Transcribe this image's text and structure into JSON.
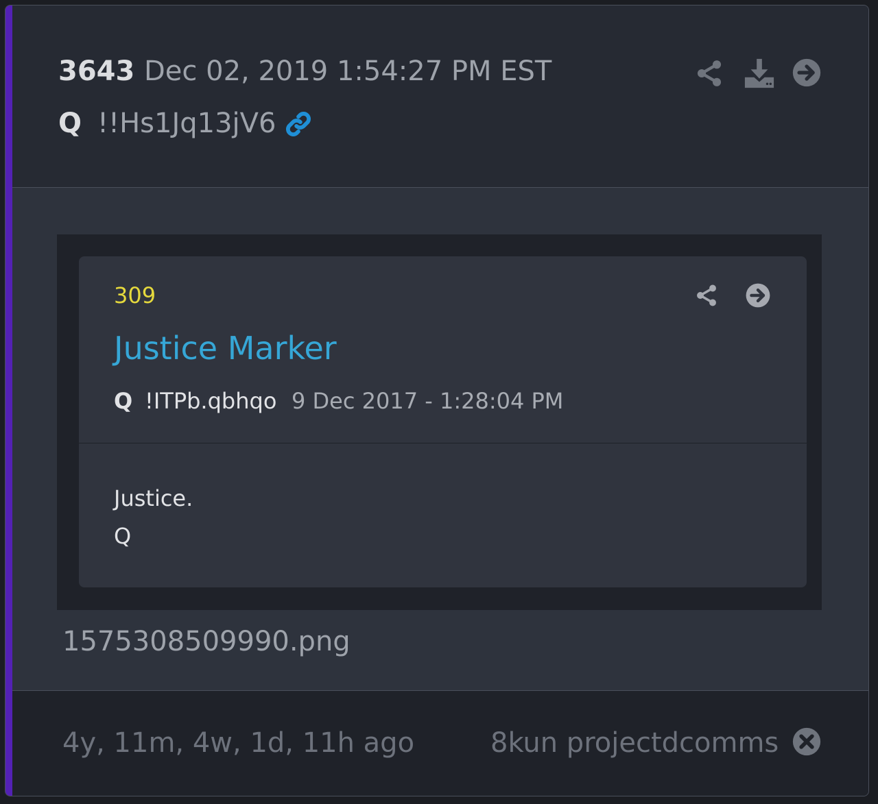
{
  "post": {
    "number": "3643",
    "date": "Dec 02, 2019 1:54:27 PM EST",
    "author": "Q",
    "tripcode": "!!Hs1Jq13jV6"
  },
  "header_icons": [
    "share-icon",
    "download-icon",
    "arrow-right-circle-icon"
  ],
  "quoted_post": {
    "number": "309",
    "title": "Justice Marker",
    "author": "Q",
    "tripcode": "!ITPb.qbhqo",
    "date": "9 Dec 2017 - 1:28:04 PM",
    "text_line1": "Justice.",
    "text_line2": "Q"
  },
  "attachment": {
    "filename": "1575308509990.png"
  },
  "footer": {
    "elapsed": "4y, 11m, 4w, 1d, 11h ago",
    "source": "8kun projectdcomms"
  },
  "colors": {
    "accent_bar": "#5321b4",
    "quoted_number": "#e5d93d",
    "quoted_title": "#36a7d7",
    "link_icon": "#1f8fd6"
  }
}
